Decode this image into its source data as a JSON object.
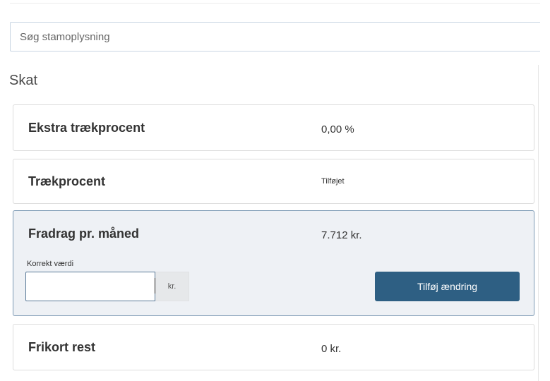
{
  "search": {
    "placeholder": "Søg stamoplysning"
  },
  "section": {
    "title": "Skat"
  },
  "rows": [
    {
      "label": "Ekstra trækprocent",
      "value": "0,00 %"
    },
    {
      "label": "Trækprocent",
      "value": "Tilføjet"
    },
    {
      "label": "Fradrag pr. måned",
      "value": "7.712 kr.",
      "edit": {
        "field_label": "Korrekt værdi",
        "input_value": "",
        "unit": "kr.",
        "button_label": "Tilføj ændring"
      }
    },
    {
      "label": "Frikort rest",
      "value": "0 kr."
    }
  ],
  "colors": {
    "primary_button": "#2e5f83",
    "active_card_bg": "#eef1f5",
    "active_card_border": "#7d9ab4"
  }
}
